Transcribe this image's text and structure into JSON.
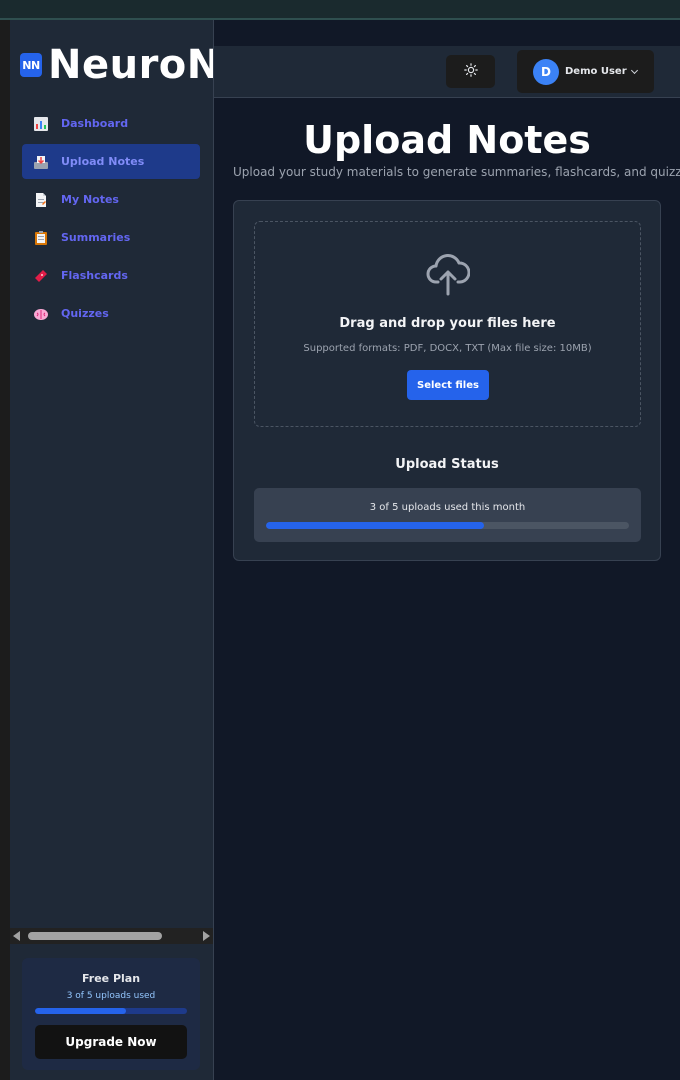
{
  "brand": {
    "logo_text": "NN",
    "name": "NeuroNotes"
  },
  "sidebar": {
    "items": [
      {
        "label": "Dashboard",
        "icon": "bar-chart-icon",
        "active": false
      },
      {
        "label": "Upload Notes",
        "icon": "inbox-tray-icon",
        "active": true
      },
      {
        "label": "My Notes",
        "icon": "page-icon",
        "active": false
      },
      {
        "label": "Summaries",
        "icon": "clipboard-icon",
        "active": false
      },
      {
        "label": "Flashcards",
        "icon": "ticket-icon",
        "active": false
      },
      {
        "label": "Quizzes",
        "icon": "brain-icon",
        "active": false
      }
    ],
    "plan": {
      "title": "Free Plan",
      "usage": "3 of 5 uploads used",
      "progress": 0.6,
      "upgrade_label": "Upgrade Now"
    }
  },
  "header": {
    "theme_icon": "sun-icon",
    "user": {
      "initial": "D",
      "name": "Demo User"
    }
  },
  "main": {
    "title": "Upload Notes",
    "subtitle": "Upload your study materials to generate summaries, flashcards, and quizzes",
    "dropzone": {
      "icon": "cloud-upload-icon",
      "title": "Drag and drop your files here",
      "formats": "Supported formats: PDF, DOCX, TXT (Max file size: 10MB)",
      "button_label": "Select files"
    },
    "status": {
      "title": "Upload Status",
      "text": "3 of 5 uploads used this month",
      "progress": 0.6
    }
  },
  "colors": {
    "accent": "#2563eb",
    "background": "#111827",
    "panel": "#1f2937"
  }
}
